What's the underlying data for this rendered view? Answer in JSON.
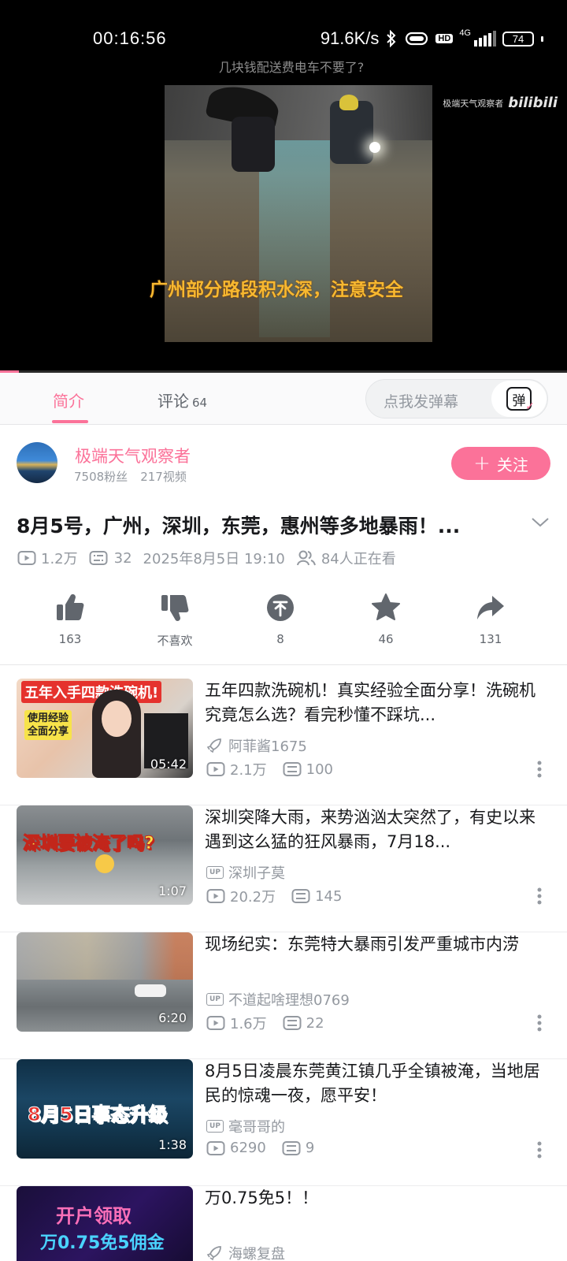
{
  "status_bar": {
    "time": "00:16:56",
    "net_speed": "91.6K/s",
    "signal_label": "4G",
    "hd_label": "HD",
    "battery": "74"
  },
  "player": {
    "title": "几块钱配送费电车不要了?",
    "subtitle": "广州部分路段积水深，注意安全",
    "watermark_channel": "极端天气观察者",
    "watermark_logo": "bilibili",
    "progress_fraction": 0.033
  },
  "tabs": {
    "intro": "简介",
    "comments": "评论",
    "comments_count": "64",
    "danmaku_placeholder": "点我发弹幕",
    "danmaku_button": "弹"
  },
  "uploader": {
    "name": "极端天气观察者",
    "fans": "7508粉丝",
    "videos": "217视频",
    "follow_label": "关注",
    "follow_plus": "+"
  },
  "video": {
    "headline": "8月5号，广州，深圳，东莞，惠州等多地暴雨！...",
    "views": "1.2万",
    "danmaku": "32",
    "date": "2025年8月5日 19:10",
    "watching": "84人正在看"
  },
  "actions": [
    {
      "icon": "thumbs-up-icon",
      "label": "163"
    },
    {
      "icon": "thumbs-down-icon",
      "label": "不喜欢"
    },
    {
      "icon": "coin-icon",
      "label": "8"
    },
    {
      "icon": "star-icon",
      "label": "46"
    },
    {
      "icon": "share-icon",
      "label": "131"
    }
  ],
  "related": [
    {
      "title": "五年四款洗碗机！真实经验全面分享！洗碗机究竟怎么选？看完秒懂不踩坑...",
      "author": "阿菲酱1675",
      "author_badge": "rocket",
      "views": "2.1万",
      "danmaku": "100",
      "duration": "05:42",
      "thumb_text": "五年入手四款洗碗机!",
      "thumb_text2": "使用经验\n全面分享"
    },
    {
      "title": "深圳突降大雨，来势汹汹太突然了，有史以来遇到这么猛的狂风暴雨，7月18...",
      "author": "深圳子莫",
      "author_badge": "UP",
      "views": "20.2万",
      "danmaku": "145",
      "duration": "1:07",
      "thumb_text": "深圳要被淹了吗?"
    },
    {
      "title": "现场纪实：东莞特大暴雨引发严重城市内涝",
      "author": "不道起啥理想0769",
      "author_badge": "UP",
      "views": "1.6万",
      "danmaku": "22",
      "duration": "6:20",
      "thumb_text": ""
    },
    {
      "title": "8月5日凌晨东莞黄江镇几乎全镇被淹，当地居民的惊魂一夜，愿平安！",
      "author": "毫哥哥的",
      "author_badge": "UP",
      "views": "6290",
      "danmaku": "9",
      "duration": "1:38",
      "thumb_text": "8月5日事态升级"
    },
    {
      "title": "万0.75免5！！",
      "author": "海螺复盘",
      "author_badge": "rocket",
      "views": "",
      "danmaku": "",
      "duration": "",
      "thumb_text": "开户领取",
      "thumb_text2": "万0.75免5佣金"
    }
  ],
  "colors": {
    "accent": "#fb7299",
    "text": "#18191c",
    "secondary": "#9499a0",
    "subtitle": "#f7b830"
  }
}
